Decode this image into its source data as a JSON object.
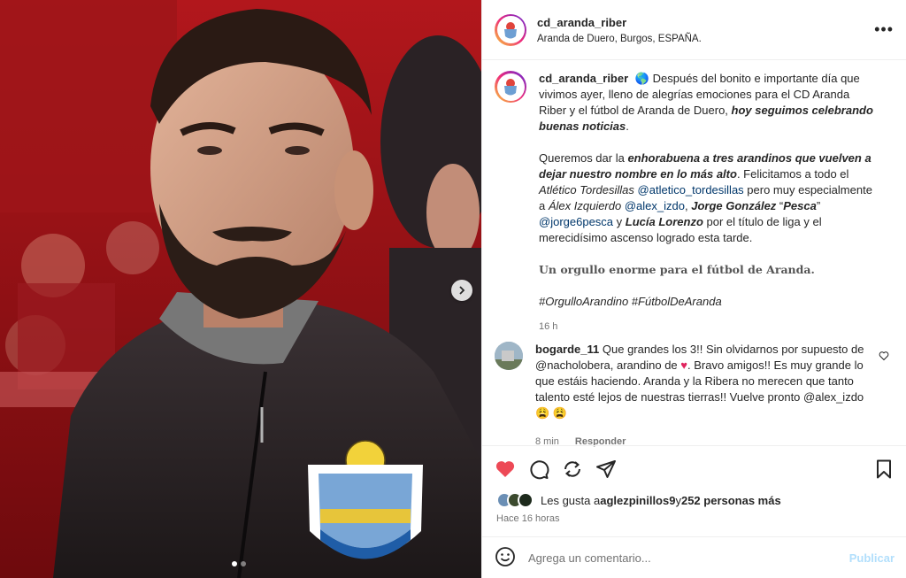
{
  "post": {
    "username": "cd_aranda_riber",
    "location": "Aranda de Duero, Burgos, ESPAÑA.",
    "more_label": "•••"
  },
  "caption": {
    "username": "cd_aranda_riber",
    "globe": "🌎",
    "p1_a": "Después del bonito e importante día que vivimos ayer, lleno de alegrías emociones para el CD Aranda Riber y el fútbol de Aranda de Duero, ",
    "p1_b": "hoy seguimos celebrando buenas noticias",
    "p1_c": ".",
    "p2_a": "Queremos dar la ",
    "p2_b": "enhorabuena a tres arandinos que vuelven a dejar nuestro nombre en lo más alto",
    "p2_c": ". Felicitamos a todo el ",
    "p2_d": "Atlético Tordesillas",
    "p2_e": "@atletico_tordesillas",
    "p2_f": " pero muy especialmente a ",
    "p2_g": "Álex Izquierdo",
    "p2_h": "@alex_izdo",
    "p2_i": ", ",
    "p2_j": "Jorge González",
    "p2_k": "“",
    "p2_l": "Pesca",
    "p2_m": "”",
    "p2_n": "@jorge6pesca",
    "p2_o": " y ",
    "p2_p": "Lucía Lorenzo",
    "p2_q": " por el título de liga y el merecidísimo ascenso logrado esta tarde.",
    "p3": "Un orgullo enorme para el fútbol de Aranda.",
    "p4": "#OrgulloArandino #FútbolDeAranda",
    "time": "16 h"
  },
  "comment": {
    "username": "bogarde_11",
    "t1": "Que grandes los 3!! Sin olvidarnos por supuesto de ",
    "mention1": "@nacholobera",
    "t2": ", arandino de ",
    "t3": ". Bravo amigos!! Es muy grande lo que estáis haciendo. Aranda y la Ribera no merecen que tanto talento esté lejos de nuestras tierras!! Vuelve pronto ",
    "mention2": "@alex_izdo",
    "emojis": " 😩 😩",
    "time": "8 min",
    "reply": "Responder"
  },
  "likes": {
    "prefix": "Les gusta a ",
    "user": "aglezpinillos9",
    "mid": " y ",
    "count": "252 personas más"
  },
  "ago": "Hace 16 horas",
  "add_comment": {
    "placeholder": "Agrega un comentario...",
    "publish": "Publicar"
  },
  "colors": {
    "like_red": "#ed4956",
    "link_blue": "#00376b",
    "publish_blue": "#b2dffc"
  },
  "icons": [
    "heart-icon",
    "comment-icon",
    "share-icon",
    "send-icon",
    "bookmark-icon",
    "emoji-icon",
    "more-icon",
    "chevron-right-icon",
    "like-small-icon"
  ]
}
